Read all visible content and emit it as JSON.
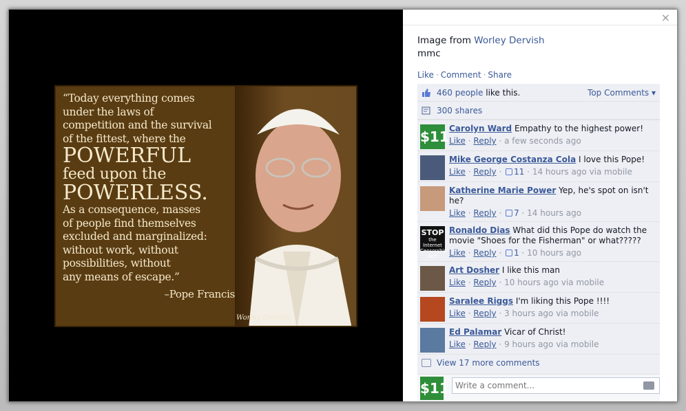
{
  "post": {
    "image_quote": {
      "line1": "“Today everything comes",
      "line2": "under the laws of",
      "line3": "competition and the survival",
      "line4": "of the fittest, where the",
      "big1": "POWERFUL",
      "line5": "feed upon the",
      "big2": "POWERLESS.",
      "line6": "As a consequence, masses",
      "line7": "of people find themselves",
      "line8": "excluded and marginalized:",
      "line9": "without work, without",
      "line10": "possibilities, without",
      "line11": "any means of escape.”",
      "signature": "–Pope Francis",
      "watermark": "Worley Dervish"
    },
    "header_prefix": "Image from",
    "author": "Worley Dervish",
    "caption": "mmc",
    "actions": [
      "Like",
      "Comment",
      "Share"
    ],
    "likes_count": "460 people",
    "likes_suffix": "like this.",
    "top_comments": "Top Comments ▾",
    "shares": "300 shares",
    "view_more": "View 17 more comments",
    "compose_placeholder": "Write a comment...",
    "close": "×"
  },
  "comments": [
    {
      "name": "Carolyn Ward",
      "text": "Empathy to the highest power!",
      "likes": "",
      "time": "a few seconds ago"
    },
    {
      "name": "Mike George Costanza Cola",
      "text": "I love this Pope!",
      "likes": "11",
      "time": "14 hours ago via mobile"
    },
    {
      "name": "Katherine Marie Power",
      "text": "Yep, he's spot on isn't he?",
      "likes": "7",
      "time": "14 hours ago"
    },
    {
      "name": "Ronaldo Dias",
      "text": "What did this Pope do watch the movie \"Shoes for the Fisherman\" or what?????",
      "likes": "1",
      "time": "10 hours ago"
    },
    {
      "name": "Art Dosher",
      "text": "I like this man",
      "likes": "",
      "time": "10 hours ago via mobile"
    },
    {
      "name": "Saralee Riggs",
      "text": "I'm liking this Pope !!!!",
      "likes": "",
      "time": "3 hours ago via mobile"
    },
    {
      "name": "Ed Palamar",
      "text": "Vicar of Christ!",
      "likes": "",
      "time": "9 hours ago via mobile"
    }
  ],
  "labels": {
    "like": "Like",
    "reply": "Reply"
  },
  "avatars": {
    "green_badge": "$11",
    "stop_title": "STOP",
    "stop_sub": "the Internet Censorship Act!"
  }
}
